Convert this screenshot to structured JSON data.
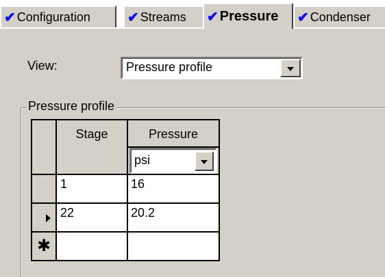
{
  "tabs": [
    {
      "label": "Configuration",
      "checked": true,
      "active": false
    },
    {
      "label": "Streams",
      "checked": true,
      "active": false
    },
    {
      "label": "Pressure",
      "checked": true,
      "active": true
    },
    {
      "label": "Condenser",
      "checked": true,
      "active": false
    }
  ],
  "check_glyph": "✔",
  "view": {
    "label": "View:",
    "selected": "Pressure profile"
  },
  "group": {
    "title": "Pressure profile"
  },
  "grid": {
    "columns": [
      "Stage",
      "Pressure"
    ],
    "units": "psi",
    "rows": [
      {
        "stage": "1",
        "pressure": "16",
        "current": false
      },
      {
        "stage": "22",
        "pressure": "20.2",
        "current": true
      }
    ],
    "new_row_glyph": "✱"
  },
  "colors": {
    "background": "#d4d0c8",
    "check": "#0000ff"
  }
}
